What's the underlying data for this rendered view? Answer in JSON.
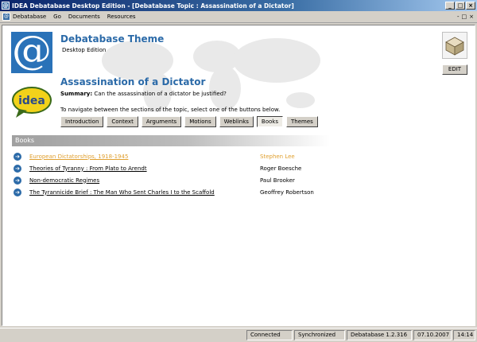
{
  "window": {
    "title": "IDEA Debatabase Desktop Edition - [Debatabase Topic : Assassination of a Dictator]",
    "buttons": {
      "minimize": "_",
      "maximize": "□",
      "close": "×"
    }
  },
  "menubar": {
    "items": [
      "Debatabase",
      "Go",
      "Documents",
      "Resources"
    ],
    "mdi_controls": [
      "-",
      "□",
      "×"
    ]
  },
  "header": {
    "brand_title": "Debatabase Theme",
    "brand_subtitle": "Desktop Edition",
    "logo_glyph": "@",
    "idea_logo_text": "idea"
  },
  "topic": {
    "title": "Assassination of a Dictator",
    "summary_label": "Summary:",
    "summary_text": "Can the assassination of a dictator be justified?",
    "nav_hint": "To navigate between the sections of the topic, select one of the buttons below."
  },
  "nav_buttons": [
    {
      "label": "Introduction",
      "active": false
    },
    {
      "label": "Context",
      "active": false
    },
    {
      "label": "Arguments",
      "active": false
    },
    {
      "label": "Motions",
      "active": false
    },
    {
      "label": "Weblinks",
      "active": false
    },
    {
      "label": "Books",
      "active": true
    },
    {
      "label": "Themes",
      "active": false
    }
  ],
  "edit": {
    "label": "EDIT"
  },
  "section": {
    "title": "Books"
  },
  "books": [
    {
      "title": "European Dictatorships, 1918-1945",
      "author": "Stephen Lee",
      "highlighted": true
    },
    {
      "title": "Theories of Tyranny : From Plato to Arendt",
      "author": "Roger Boesche",
      "highlighted": false
    },
    {
      "title": "Non-democratic Regimes",
      "author": "Paul Brooker",
      "highlighted": false
    },
    {
      "title": "The Tyrannicide Brief : The Man Who Sent Charles I to the Scaffold",
      "author": "Geoffrey Robertson",
      "highlighted": false
    }
  ],
  "statusbar": {
    "connection": "Connected",
    "sync": "Synchronized",
    "version": "Debatabase 1.2.316",
    "date": "07.10.2007",
    "time": "14:14"
  },
  "colors": {
    "accent_blue": "#2b6aa8",
    "highlight_orange": "#e0a030",
    "titlebar_start": "#0a246a"
  }
}
